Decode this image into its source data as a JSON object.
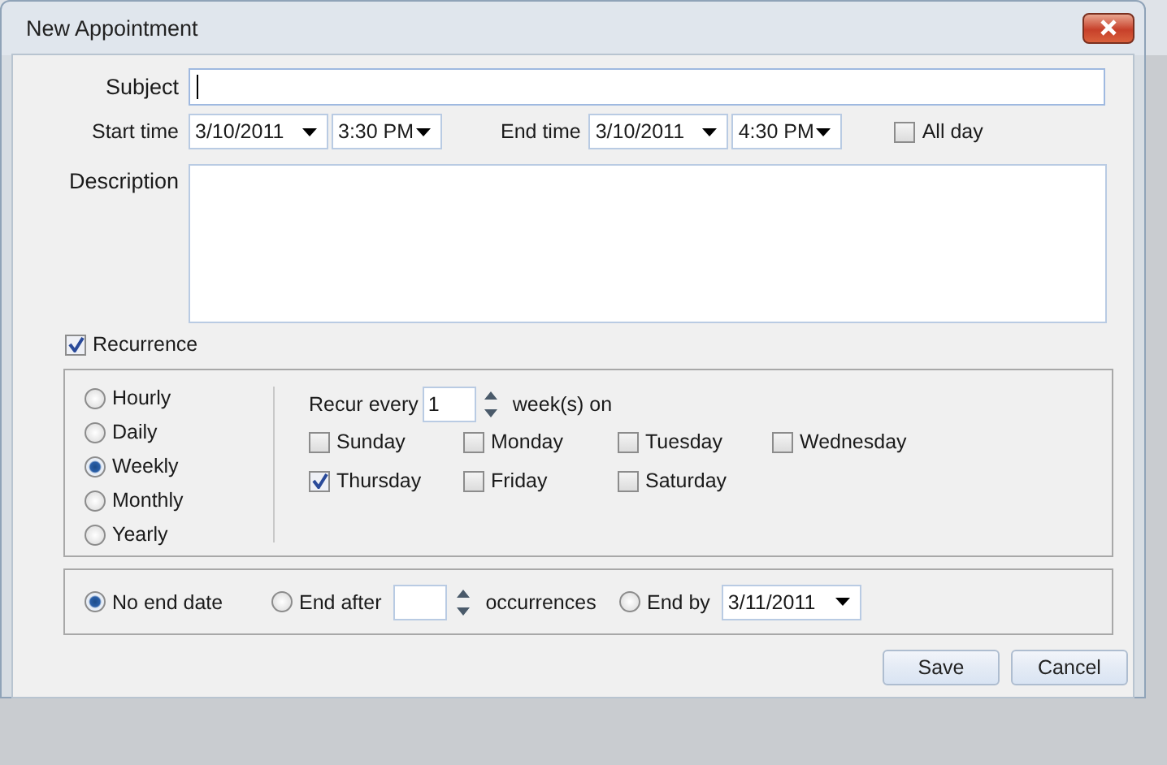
{
  "window": {
    "title": "New Appointment"
  },
  "subject": {
    "label": "Subject",
    "focused": true
  },
  "start_time": {
    "label": "Start time",
    "date": "3/10/2011",
    "time": "3:30 PM"
  },
  "end_time": {
    "label": "End time",
    "date": "3/10/2011",
    "time": "4:30 PM"
  },
  "all_day": {
    "label": "All day",
    "checked": false
  },
  "description": {
    "label": "Description"
  },
  "recurrence": {
    "label": "Recurrence",
    "checked": true
  },
  "frequencies": [
    {
      "label": "Hourly",
      "selected": false
    },
    {
      "label": "Daily",
      "selected": false
    },
    {
      "label": "Weekly",
      "selected": true
    },
    {
      "label": "Monthly",
      "selected": false
    },
    {
      "label": "Yearly",
      "selected": false
    }
  ],
  "recur_every": {
    "prefix": "Recur every",
    "value": "1",
    "suffix": "week(s) on"
  },
  "days": [
    {
      "label": "Sunday",
      "checked": false
    },
    {
      "label": "Monday",
      "checked": false
    },
    {
      "label": "Tuesday",
      "checked": false
    },
    {
      "label": "Wednesday",
      "checked": false
    },
    {
      "label": "Thursday",
      "checked": true
    },
    {
      "label": "Friday",
      "checked": false
    },
    {
      "label": "Saturday",
      "checked": false
    }
  ],
  "end_options": [
    {
      "kind": "none",
      "label": "No end date",
      "selected": true
    },
    {
      "kind": "after",
      "label": "End after",
      "suffix": "occurrences",
      "selected": false
    },
    {
      "kind": "by",
      "label": "End by",
      "date": "3/11/2011",
      "selected": false
    }
  ],
  "buttons": [
    "Save",
    "Cancel"
  ]
}
